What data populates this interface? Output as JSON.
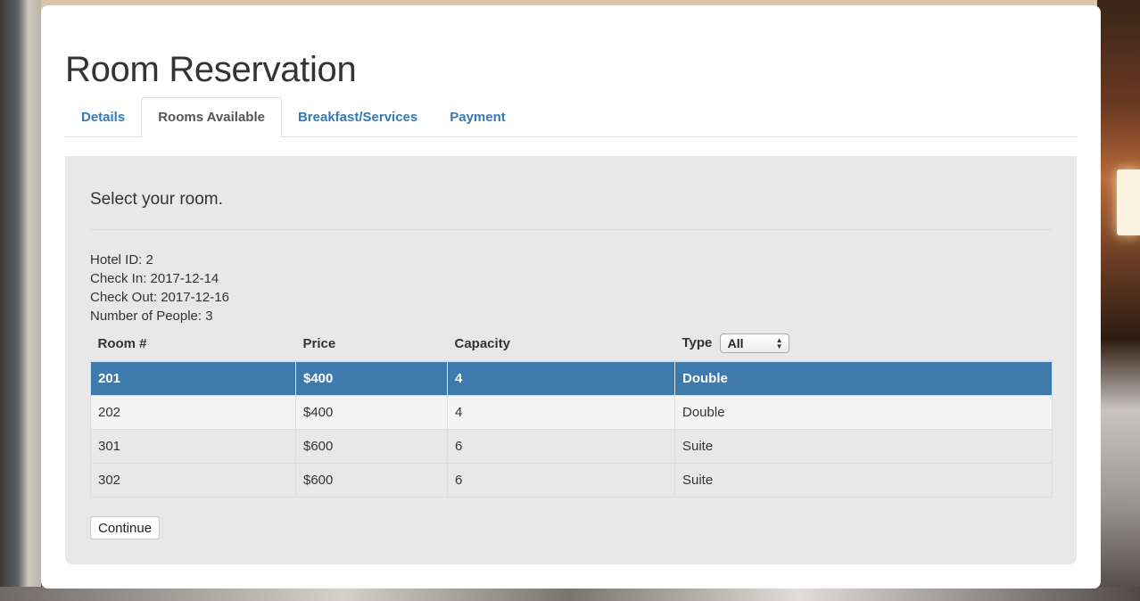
{
  "page": {
    "title": "Room Reservation"
  },
  "tabs": [
    {
      "label": "Details",
      "active": false
    },
    {
      "label": "Rooms Available",
      "active": true
    },
    {
      "label": "Breakfast/Services",
      "active": false
    },
    {
      "label": "Payment",
      "active": false
    }
  ],
  "content": {
    "heading": "Select your room.",
    "info": {
      "hotel_id": "Hotel ID: 2",
      "check_in": "Check In: 2017-12-14",
      "check_out": "Check Out: 2017-12-16",
      "people": "Number of People: 3"
    },
    "table": {
      "headers": {
        "room": "Room #",
        "price": "Price",
        "capacity": "Capacity",
        "type": "Type"
      },
      "type_filter": {
        "selected": "All",
        "arrows_icon": "up-down-arrows-icon"
      },
      "rows": [
        {
          "room": "201",
          "price": "$400",
          "capacity": "4",
          "type": "Double",
          "selected": true
        },
        {
          "room": "202",
          "price": "$400",
          "capacity": "4",
          "type": "Double",
          "selected": false
        },
        {
          "room": "301",
          "price": "$600",
          "capacity": "6",
          "type": "Suite",
          "selected": false
        },
        {
          "room": "302",
          "price": "$600",
          "capacity": "6",
          "type": "Suite",
          "selected": false
        }
      ]
    },
    "continue_label": "Continue"
  },
  "colors": {
    "link": "#337ab7",
    "selected_row": "#3e7aab",
    "content_bg": "#e8e8e8"
  }
}
